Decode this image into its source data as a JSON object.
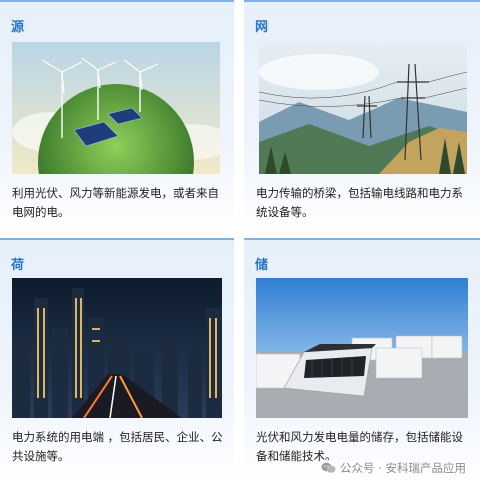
{
  "cards": [
    {
      "title": "源",
      "description": "利用光伏、风力等新能源发电，或者来自电网的电。"
    },
    {
      "title": "网",
      "description": "电力传输的桥梁，包括输电线路和电力系统设备等。"
    },
    {
      "title": "荷",
      "description": "电力系统的用电端 ，包括居民、企业、公共设施等。"
    },
    {
      "title": "储",
      "description": "光伏和风力发电电量的储存，包括储能设备和储能技术。"
    }
  ],
  "watermark": {
    "text": "公众号 · 安科瑞产品应用",
    "icon": "wechat-icon"
  },
  "colors": {
    "accent": "#2a76c9",
    "card_border": "#7fb1e6"
  }
}
